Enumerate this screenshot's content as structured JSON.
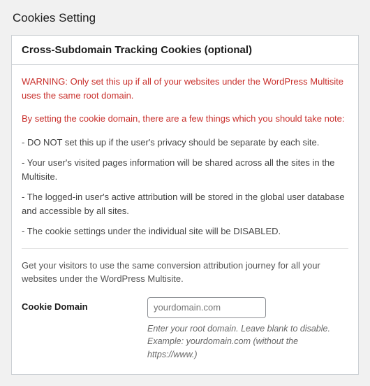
{
  "page": {
    "title": "Cookies Setting"
  },
  "panel": {
    "heading": "Cross-Subdomain Tracking Cookies (optional)",
    "warning_label": "WARNING:",
    "warning_text": " Only set this up if all of your websites under the WordPress Multisite uses the same root domain.",
    "note_intro": "By setting the cookie domain, there are a few things which you should take note:",
    "bullets": [
      "- DO NOT set this up if the user's privacy should be separate by each site.",
      "- Your user's visited pages information will be shared across all the sites in the Multisite.",
      "- The logged-in user's active attribution will be stored in the global user database and accessible by all sites.",
      "- The cookie settings under the individual site will be DISABLED."
    ],
    "description": "Get your visitors to use the same conversion attribution journey for all your websites under the WordPress Multisite."
  },
  "field": {
    "label": "Cookie Domain",
    "value": "",
    "placeholder": "yourdomain.com",
    "help": "Enter your root domain. Leave blank to disable. Example: yourdomain.com (without the https://www.)"
  }
}
